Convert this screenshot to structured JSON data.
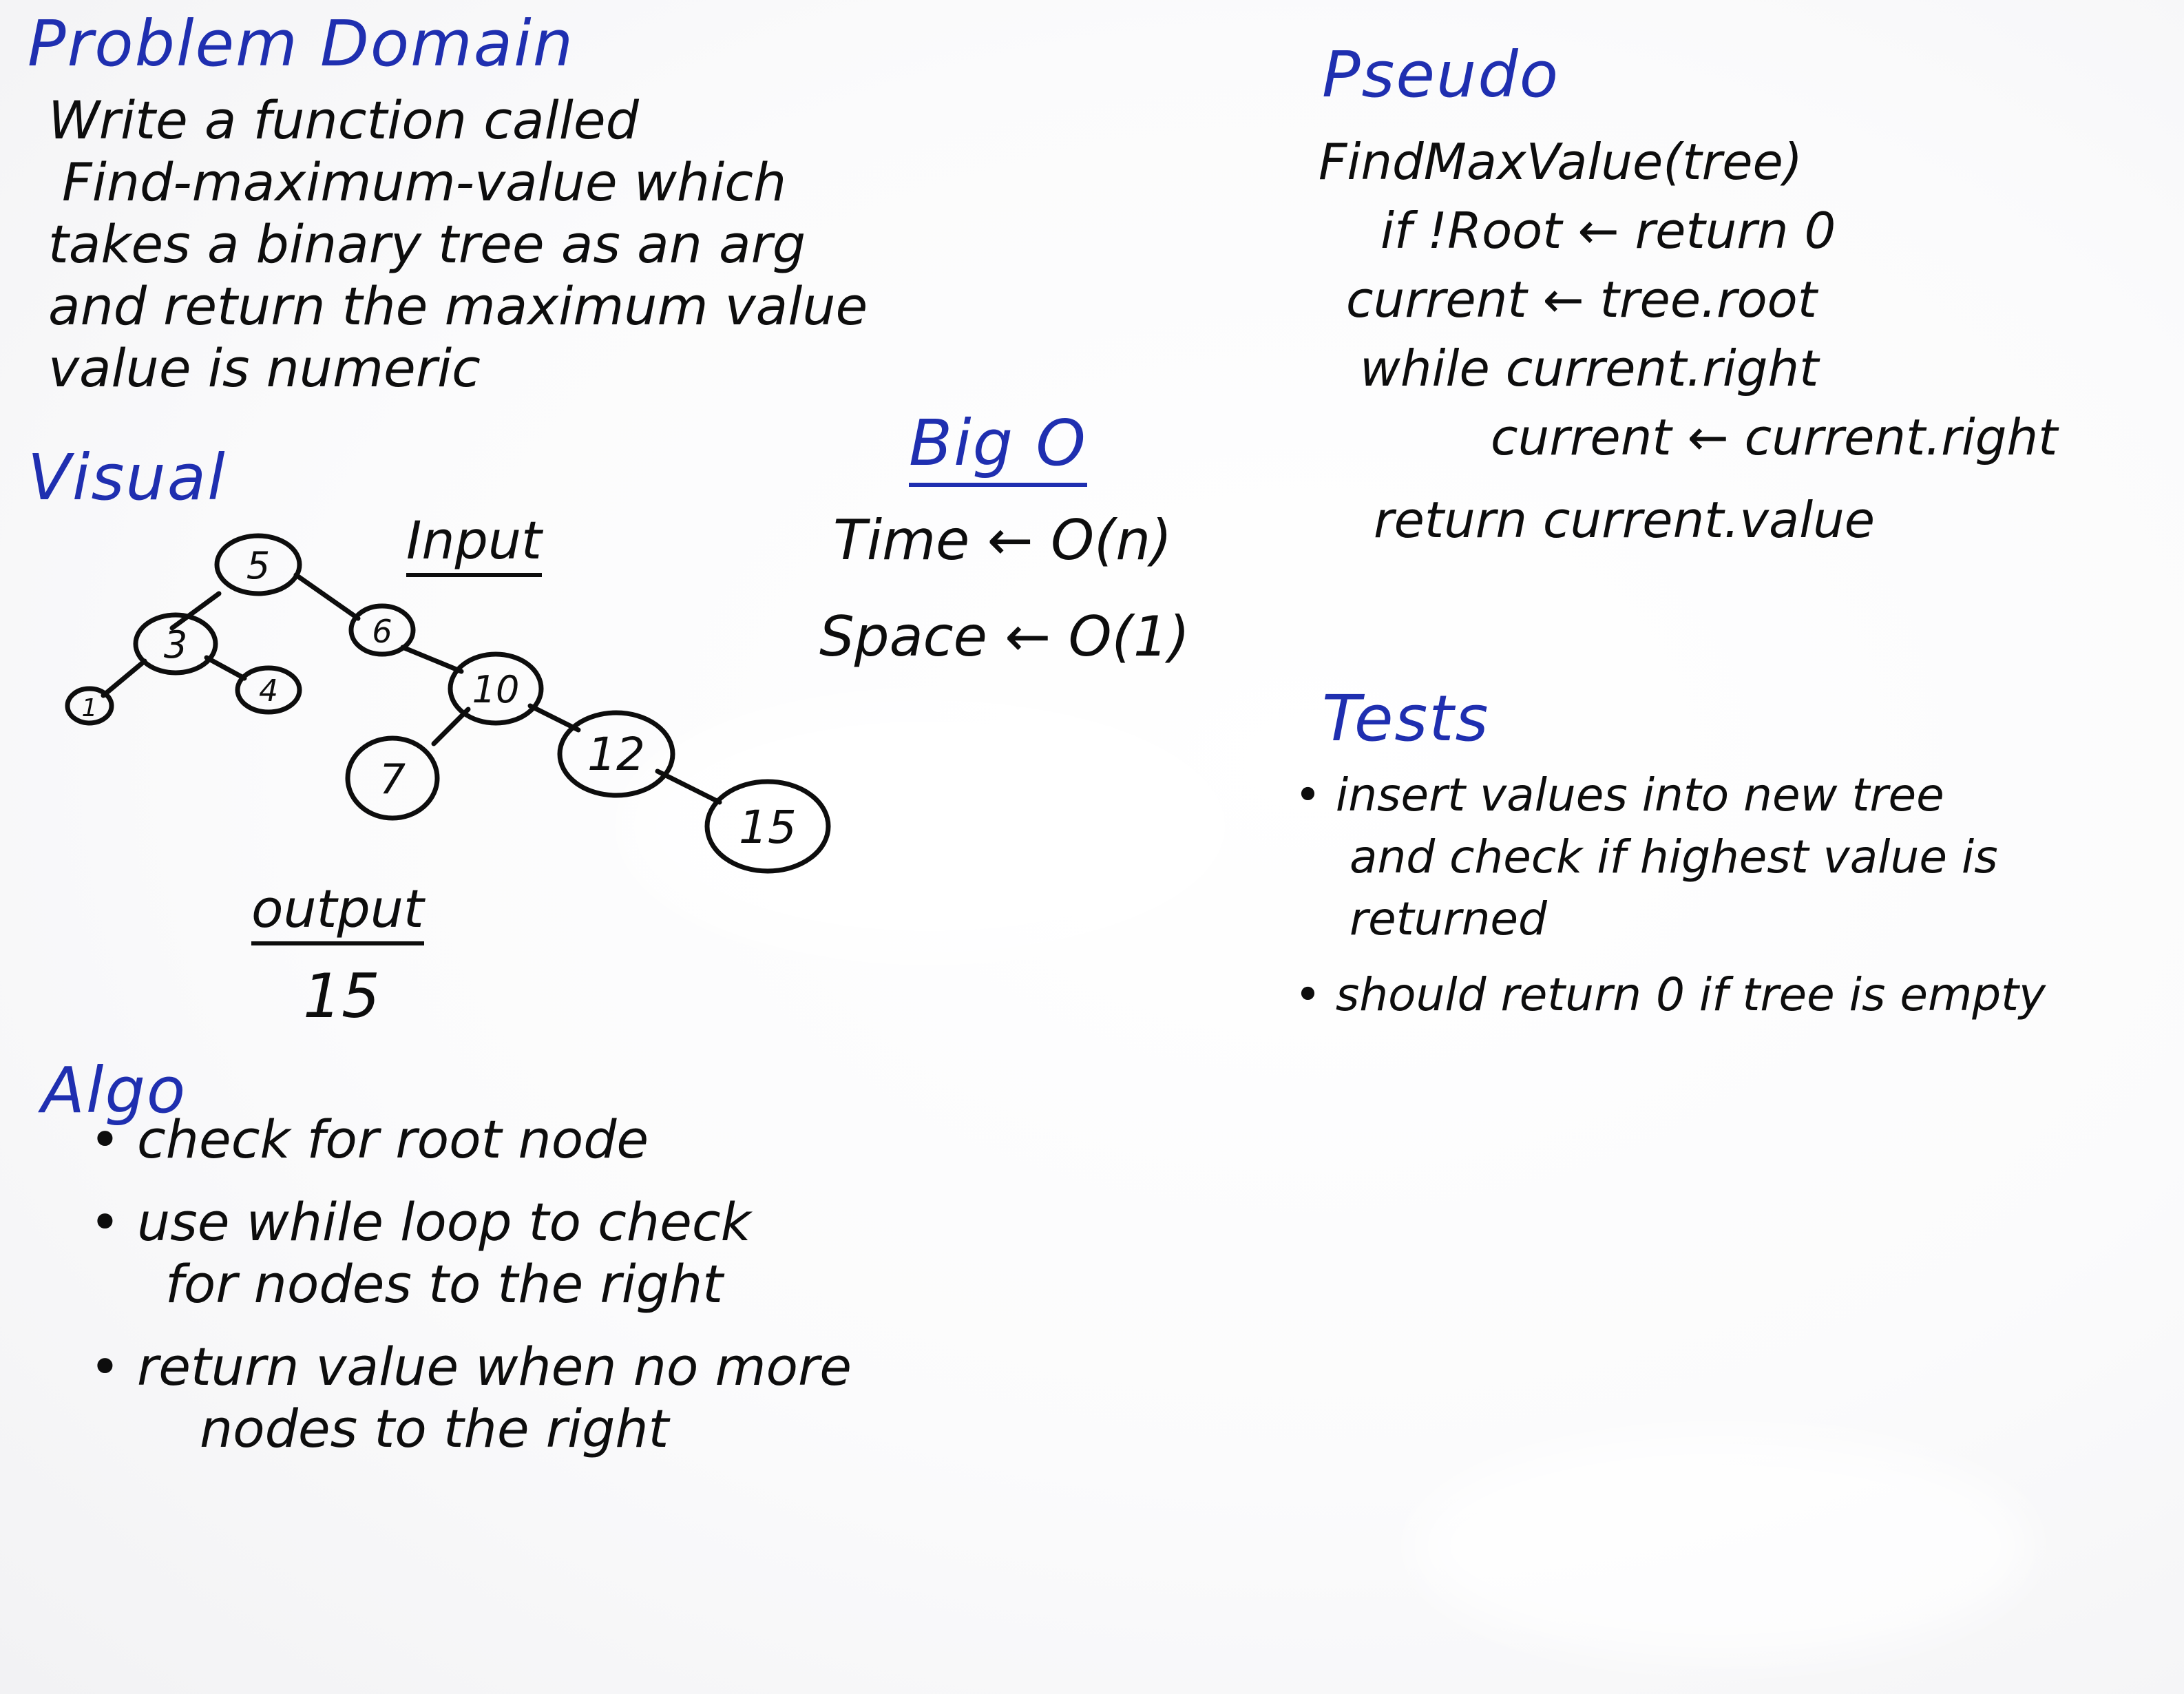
{
  "problem_domain": {
    "heading": "Problem Domain",
    "lines": [
      "Write a function called",
      "Find-maximum-value which",
      "takes a binary tree as an arg",
      "and return the maximum value",
      "value is numeric"
    ]
  },
  "visual": {
    "heading": "Visual",
    "input_label": "Input",
    "tree_nodes": [
      "5",
      "3",
      "6",
      "1",
      "4",
      "10",
      "7",
      "12",
      "15"
    ],
    "output_label": "output",
    "output_value": "15"
  },
  "big_o": {
    "heading": "Big O",
    "time": "Time ← O(n)",
    "space": "Space ← O(1)"
  },
  "algo": {
    "heading": "Algo",
    "items": [
      "check for root node",
      "use while loop to check",
      "for nodes to the right",
      "return value when no more",
      "nodes to the right"
    ]
  },
  "pseudo": {
    "heading": "Pseudo",
    "lines": [
      "FindMaxValue(tree)",
      "if !Root ← return 0",
      "current ← tree.root",
      "while current.right",
      "current ← current.right",
      "return current.value"
    ]
  },
  "tests": {
    "heading": "Tests",
    "items": [
      "insert values into new tree",
      "and check if highest value is",
      "returned",
      "should return 0 if tree is empty"
    ]
  },
  "colors": {
    "heading_ink": "#1f2fb0",
    "body_ink": "#0d0d0d",
    "board": "#fbfbfc"
  }
}
